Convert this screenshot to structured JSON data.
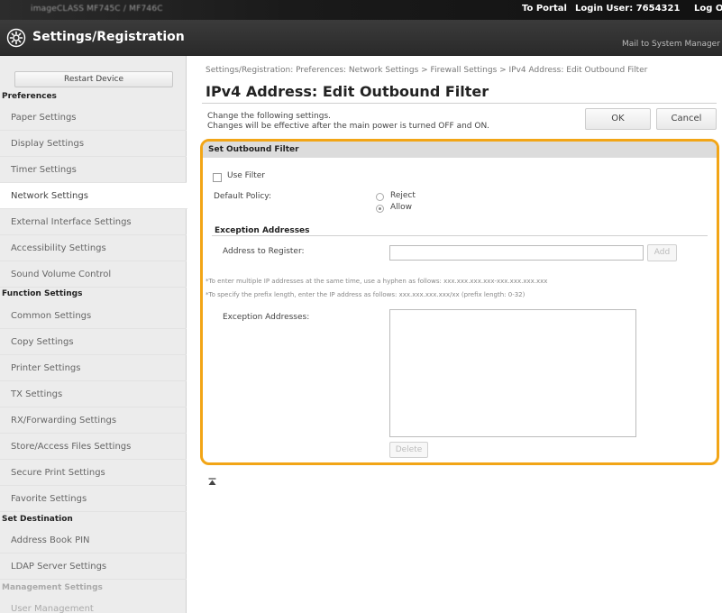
{
  "topbar": {
    "device_name": "imageCLASS MF745C / MF746C",
    "to_portal": "To Portal",
    "login_user": "Login User: 7654321",
    "logout": "Log Out"
  },
  "header": {
    "title": "Settings/Registration",
    "mail_link": "Mail to System Manager"
  },
  "sidebar": {
    "restart_button": "Restart Device",
    "sections": [
      {
        "heading": "Preferences",
        "items": [
          "Paper Settings",
          "Display Settings",
          "Timer Settings",
          "Network Settings",
          "External Interface Settings",
          "Accessibility Settings",
          "Sound Volume Control"
        ]
      },
      {
        "heading": "Function Settings",
        "items": [
          "Common Settings",
          "Copy Settings",
          "Printer Settings",
          "TX Settings",
          "RX/Forwarding Settings",
          "Store/Access Files Settings",
          "Secure Print Settings",
          "Favorite Settings"
        ]
      },
      {
        "heading": "Set Destination",
        "items": [
          "Address Book PIN",
          "LDAP Server Settings"
        ]
      },
      {
        "heading": "Management Settings",
        "items": [
          "User Management"
        ]
      }
    ],
    "active_item": "Network Settings"
  },
  "main": {
    "breadcrumb": "Settings/Registration: Preferences: Network Settings > Firewall Settings > IPv4 Address: Edit Outbound Filter",
    "title": "IPv4 Address: Edit Outbound Filter",
    "instruction_1": "Change the following settings.",
    "instruction_2": "Changes will be effective after the main power is turned OFF and ON.",
    "ok_button": "OK",
    "cancel_button": "Cancel",
    "panel": {
      "heading": "Set Outbound Filter",
      "use_filter_label": "Use Filter",
      "use_filter_checked": false,
      "default_policy_label": "Default Policy:",
      "policy_options": [
        "Reject",
        "Allow"
      ],
      "policy_selected": "Allow",
      "exception_heading": "Exception Addresses",
      "address_label": "Address to Register:",
      "address_value": "",
      "add_button": "Add",
      "note_1": "*To enter multiple IP addresses at the same time, use a hyphen as follows: xxx.xxx.xxx.xxx-xxx.xxx.xxx.xxx",
      "note_2": "*To specify the prefix length, enter the IP address as follows: xxx.xxx.xxx.xxx/xx (prefix length: 0-32)",
      "exception_list_label": "Exception Addresses:",
      "delete_button": "Delete"
    }
  },
  "colors": {
    "highlight_border": "#f2a516",
    "header_bg": "#2a2a2a",
    "sidebar_bg": "#ececec"
  }
}
